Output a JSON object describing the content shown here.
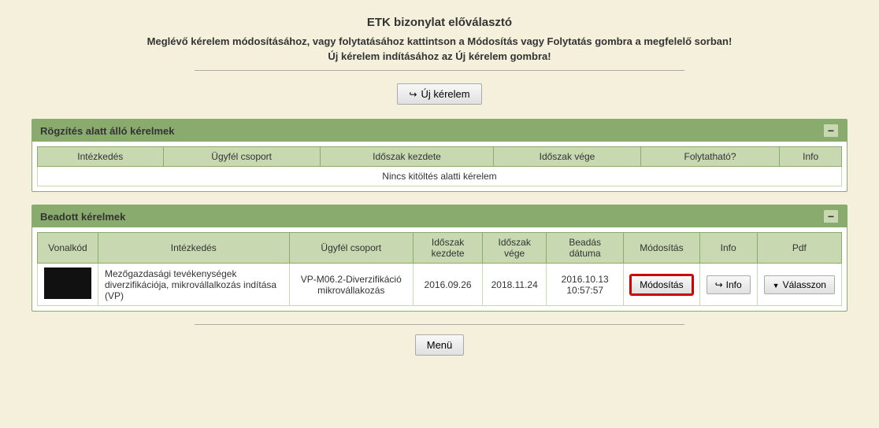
{
  "page": {
    "title": "ETK bizonylat előválasztó",
    "subtitle1": "Meglévő kérelem módosításához, vagy folytatásához kattintson a Módosítás vagy Folytatás gombra a megfelelő sorban!",
    "subtitle2": "Új kérelem indításához az Új kérelem gombra!",
    "new_request_button": "Új kérelem",
    "menu_button": "Menü"
  },
  "rogzites_section": {
    "title": "Rögzítés alatt álló kérelmek",
    "collapse_label": "−",
    "columns": [
      "Intézkedés",
      "Ügyfél csoport",
      "Időszak kezdete",
      "Időszak vége",
      "Folytatható?",
      "Info"
    ],
    "no_data_message": "Nincs kitöltés alatti kérelem"
  },
  "beadott_section": {
    "title": "Beadott kérelmek",
    "collapse_label": "−",
    "columns": [
      "Vonalkód",
      "Intézkedés",
      "Ügyfél csoport",
      "Időszak kezdete",
      "Időszak vége",
      "Beadás dátuma",
      "Módosítás",
      "Info",
      "Pdf"
    ],
    "rows": [
      {
        "vonalkod": "",
        "intezkedesek": "Mezőgazdasági tevékenységek diverzifikációja, mikrovállalkozás indítása (VP)",
        "ugyfel_csoport": "VP-M06.2-Diverzifikáció mikrovállakozás",
        "idoszak_kezdete": "2016.09.26",
        "idoszak_vege": "2018.11.24",
        "beadas_datuma": "2016.10.13 10:57:57",
        "modositas_btn": "Módosítás",
        "info_btn": "↪ Info",
        "pdf_btn": "▼ Válasszon"
      }
    ]
  }
}
